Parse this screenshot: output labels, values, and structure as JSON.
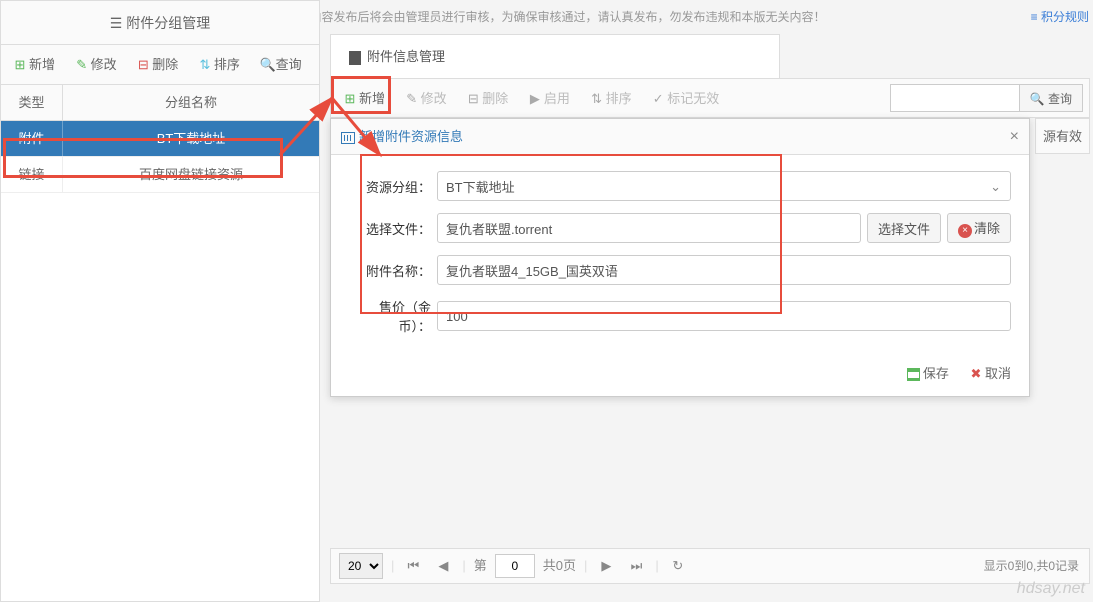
{
  "notice": "主题内容发布后将会由管理员进行审核，为确保审核通过，请认真发布，勿发布违规和本版无关内容！",
  "rules_link": "≡ 积分规则",
  "left": {
    "title": "附件分组管理",
    "toolbar": {
      "add": "新增",
      "edit": "修改",
      "delete": "删除",
      "sort": "排序",
      "query": "查询"
    },
    "columns": {
      "type": "类型",
      "name": "分组名称"
    },
    "rows": [
      {
        "type": "附件",
        "name": "BT下载地址",
        "selected": true
      },
      {
        "type": "链接",
        "name": "百度网盘链接资源",
        "selected": false
      }
    ]
  },
  "right": {
    "title": "附件信息管理",
    "toolbar": {
      "add": "新增",
      "edit": "修改",
      "delete": "删除",
      "enable": "启用",
      "sort": "排序",
      "invalid": "标记无效",
      "query": "查询"
    },
    "extra_col": "源有效"
  },
  "modal": {
    "title": "新增附件资源信息",
    "labels": {
      "group": "资源分组：",
      "file": "选择文件：",
      "name": "附件名称：",
      "price": "售价（金币）："
    },
    "values": {
      "group": "BT下载地址",
      "file": "复仇者联盟.torrent",
      "name": "复仇者联盟4_15GB_国英双语",
      "price": "100"
    },
    "buttons": {
      "choose_file": "选择文件",
      "clear": "清除",
      "save": "保存",
      "cancel": "取消"
    }
  },
  "pagination": {
    "page_size": "20",
    "page_label_prefix": "第",
    "page_value": "0",
    "page_total": "共0页",
    "count_text": "显示0到0,共0记录"
  },
  "watermark": "hdsay.net"
}
